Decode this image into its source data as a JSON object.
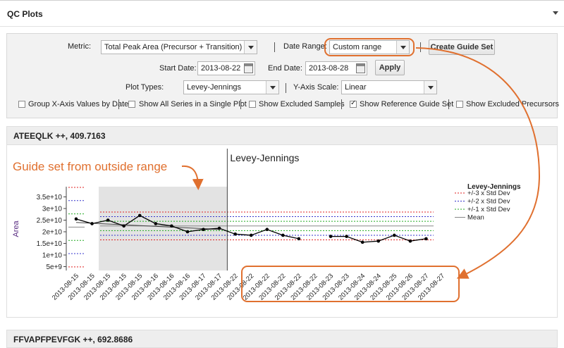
{
  "panel": {
    "title": "QC Plots"
  },
  "config": {
    "metric_label": "Metric:",
    "metric_value": "Total Peak Area (Precursor + Transition)",
    "date_range_label": "Date Range:",
    "date_range_value": "Custom range",
    "create_guide_set_label": "Create Guide Set",
    "start_date_label": "Start Date:",
    "start_date_value": "2013-08-22",
    "end_date_label": "End Date:",
    "end_date_value": "2013-08-28",
    "apply_label": "Apply",
    "plot_types_label": "Plot Types:",
    "plot_types_value": "Levey-Jennings",
    "y_axis_scale_label": "Y-Axis Scale:",
    "y_axis_scale_value": "Linear",
    "checkboxes": [
      {
        "label": "Group X-Axis Values by Date",
        "checked": false
      },
      {
        "label": "Show All Series in a Single Plot",
        "checked": false
      },
      {
        "label": "Show Excluded Samples",
        "checked": false
      },
      {
        "label": "Show Reference Guide Set",
        "checked": true
      },
      {
        "label": "Show Excluded Precursors",
        "checked": false
      }
    ]
  },
  "plots": [
    {
      "header": "ATEEQLK ++, 409.7163"
    },
    {
      "header": "FFVAPFPEVFGK ++, 692.8686"
    }
  ],
  "annotation": {
    "text": "Guide set from outside range",
    "color": "#e0702f"
  },
  "chart_data": {
    "type": "line",
    "title": "Levey-Jennings",
    "ylabel": "Area",
    "xlabel": "",
    "ylim": [
      0,
      36000000000
    ],
    "yticks": [
      5000000000,
      10000000000,
      15000000000,
      20000000000,
      25000000000,
      30000000000,
      35000000000
    ],
    "ytick_labels": [
      "5e+9",
      "1e+10",
      "1.5e+10",
      "2e+10",
      "2.5e+10",
      "3e+10",
      "3.5e+10"
    ],
    "x": [
      "2013-08-15",
      "2013-08-15",
      "2013-08-15",
      "2013-08-15",
      "2013-08-15",
      "2013-08-16",
      "2013-08-16",
      "2013-08-16",
      "2013-08-17",
      "2013-08-17",
      "2013-08-22",
      "2013-08-22",
      "2013-08-22",
      "2013-08-22",
      "2013-08-22",
      "2013-08-22",
      "2013-08-23",
      "2013-08-23",
      "2013-08-24",
      "2013-08-24",
      "2013-08-25",
      "2013-08-26",
      "2013-08-27",
      "2013-08-27"
    ],
    "series": [
      {
        "values": [
          25500000000,
          23500000000,
          25000000000,
          22500000000,
          27000000000,
          23500000000,
          22500000000,
          20000000000,
          21000000000,
          21500000000,
          19000000000,
          18500000000,
          21000000000,
          18500000000,
          17000000000,
          null,
          18000000000,
          18000000000,
          15500000000,
          16000000000,
          18500000000,
          16000000000,
          17000000000,
          null
        ]
      }
    ],
    "guide_set_trend": [
      24000000000,
      21000000000
    ],
    "guide_set_points": 10,
    "guide_set_region": {
      "from": "2013-08-15",
      "to": "2013-08-17"
    },
    "guide_set_mean": 22000000000,
    "guide_set_sd": 3000000000,
    "current_mean": 22500000000,
    "current_sd": 2000000000,
    "legend": {
      "title": "Levey-Jennings",
      "position": "right",
      "items": [
        {
          "label": "+/-3 x Std Dev",
          "color": "#e02020"
        },
        {
          "label": "+/-2 x Std Dev",
          "color": "#3333cc"
        },
        {
          "label": "+/-1 x Std Dev",
          "color": "#22aa22"
        },
        {
          "label": "Mean",
          "color": "#888888"
        }
      ]
    },
    "colors": {
      "sd3": "#e02020",
      "sd2": "#3333cc",
      "sd1": "#22aa22",
      "mean": "#888888",
      "series": "#000000",
      "guide_region": "#e3e3e3"
    }
  }
}
